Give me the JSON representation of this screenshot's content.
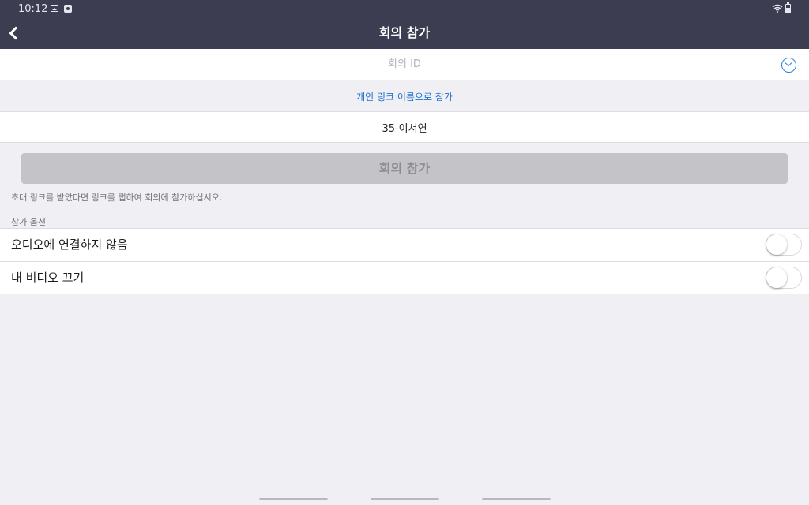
{
  "status_bar": {
    "time": "10:12",
    "icons": [
      "image-icon",
      "settings-icon",
      "wifi-icon",
      "battery-icon"
    ]
  },
  "header": {
    "title": "회의 참가",
    "back_icon": "chevron-left-icon"
  },
  "meeting_id": {
    "placeholder": "회의 ID",
    "value": "",
    "dropdown_icon": "chevron-down-circle-icon"
  },
  "personal_link": {
    "label": "개인 링크 이름으로 참가"
  },
  "display_name": {
    "value": "35-이서연"
  },
  "join_button": {
    "label": "회의 참가"
  },
  "hint": "초대 링크를 받았다면 링크를 탭하여 회의에 참가하십시오.",
  "options_section": {
    "label": "참가 옵션",
    "items": [
      {
        "label": "오디오에 연결하지 않음",
        "enabled": false
      },
      {
        "label": "내 비디오 끄기",
        "enabled": false
      }
    ]
  },
  "colors": {
    "header_bg": "#3d3d52",
    "link": "#1d6fcf",
    "page_bg": "#efeff4",
    "disabled_button": "#c4c4c8"
  }
}
